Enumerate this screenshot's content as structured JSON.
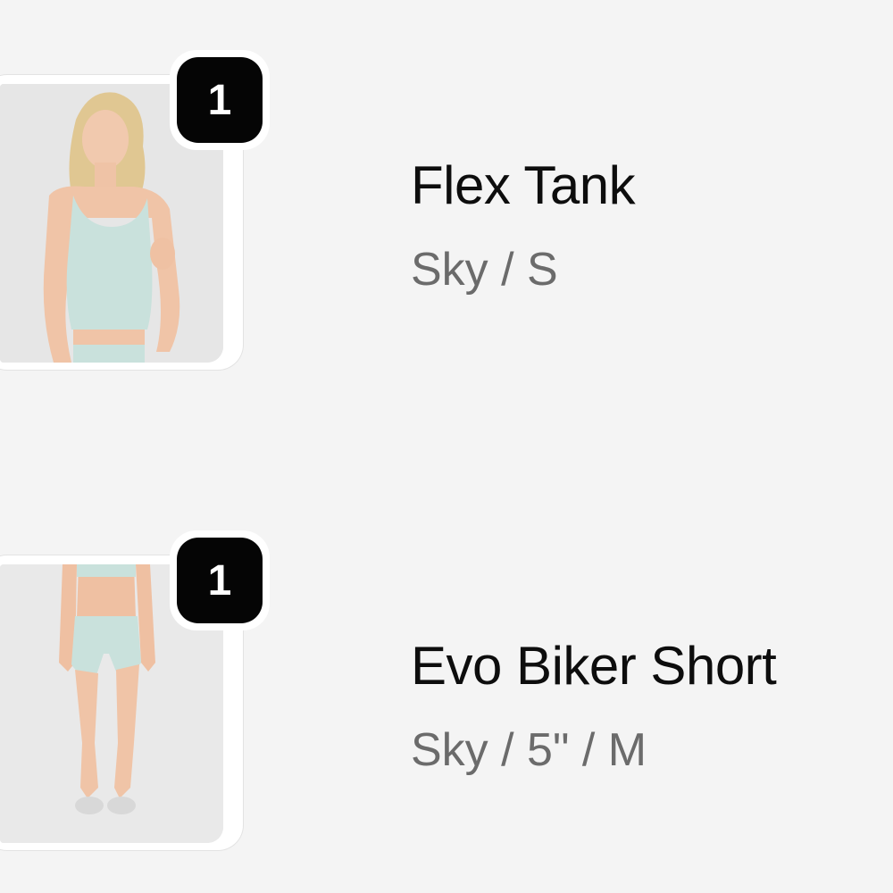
{
  "line_items": [
    {
      "title": "Flex Tank",
      "variant": "Sky / S",
      "quantity": "1",
      "thumbnail_icon": "product-photo-tank-icon"
    },
    {
      "title": "Evo Biker Short",
      "variant": "Sky / 5\" / M",
      "quantity": "1",
      "thumbnail_icon": "product-photo-shorts-icon"
    }
  ],
  "colors": {
    "background": "#f4f4f4",
    "badge": "#050505",
    "title_text": "#0d0d0d",
    "variant_text": "#6b6b6b",
    "product_color": "#c9e1dc"
  }
}
